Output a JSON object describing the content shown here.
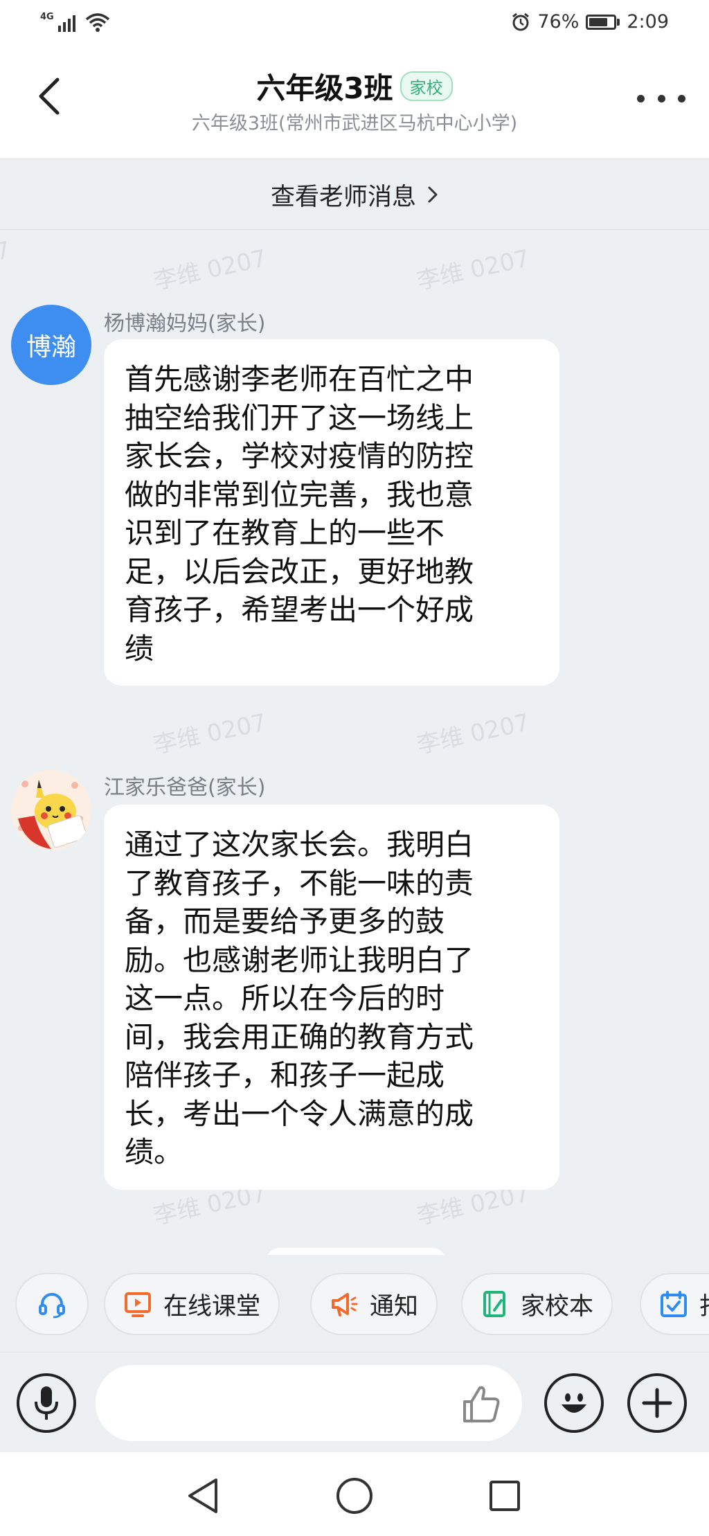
{
  "status_bar": {
    "network": "4G",
    "battery_text": "76%",
    "battery_level": 0.76,
    "time": "2:09"
  },
  "header": {
    "title": "六年级3班",
    "tag": "家校",
    "subtitle": "六年级3班(常州市武进区马杭中心小学)"
  },
  "teacher_link": {
    "label": "查看老师消息"
  },
  "watermark": "李维 0207",
  "messages": [
    {
      "sender": "杨博瀚妈妈(家长)",
      "avatar_text": "博瀚",
      "lines": [
        "首先感谢李老师在百忙之中",
        "抽空给我们开了这一场线上",
        "家长会，学校对疫情的防控",
        "做的非常到位完善，我也意",
        "识到了在教育上的一些不",
        "足，以后会改正，更好地教",
        "育孩子，希望考出一个好成",
        "绩"
      ]
    },
    {
      "sender": "江家乐爸爸(家长)",
      "avatar_text": "",
      "lines": [
        "通过了这次家长会。我明白",
        "了教育孩子，不能一味的责",
        "备，而是要给予更多的鼓",
        "励。也感谢老师让我明白了",
        "这一点。所以在今后的时",
        "间，我会用正确的教育方式",
        "陪伴孩子，和孩子一起成",
        "长，考出一个令人满意的成",
        "绩。"
      ]
    }
  ],
  "toolbar": {
    "items": [
      {
        "label": "",
        "icon": "headset-icon"
      },
      {
        "label": "在线课堂",
        "icon": "live-class-icon"
      },
      {
        "label": "通知",
        "icon": "megaphone-icon"
      },
      {
        "label": "家校本",
        "icon": "notebook-icon"
      },
      {
        "label": "打",
        "icon": "calendar-check-icon"
      }
    ]
  },
  "input_bar": {
    "placeholder": ""
  },
  "colors": {
    "accent_blue": "#3d8ef0",
    "tag_green": "#2fb27a",
    "live_orange": "#f26b2c",
    "notebook_green": "#1fb57a",
    "calendar_blue": "#2f8cf0"
  }
}
